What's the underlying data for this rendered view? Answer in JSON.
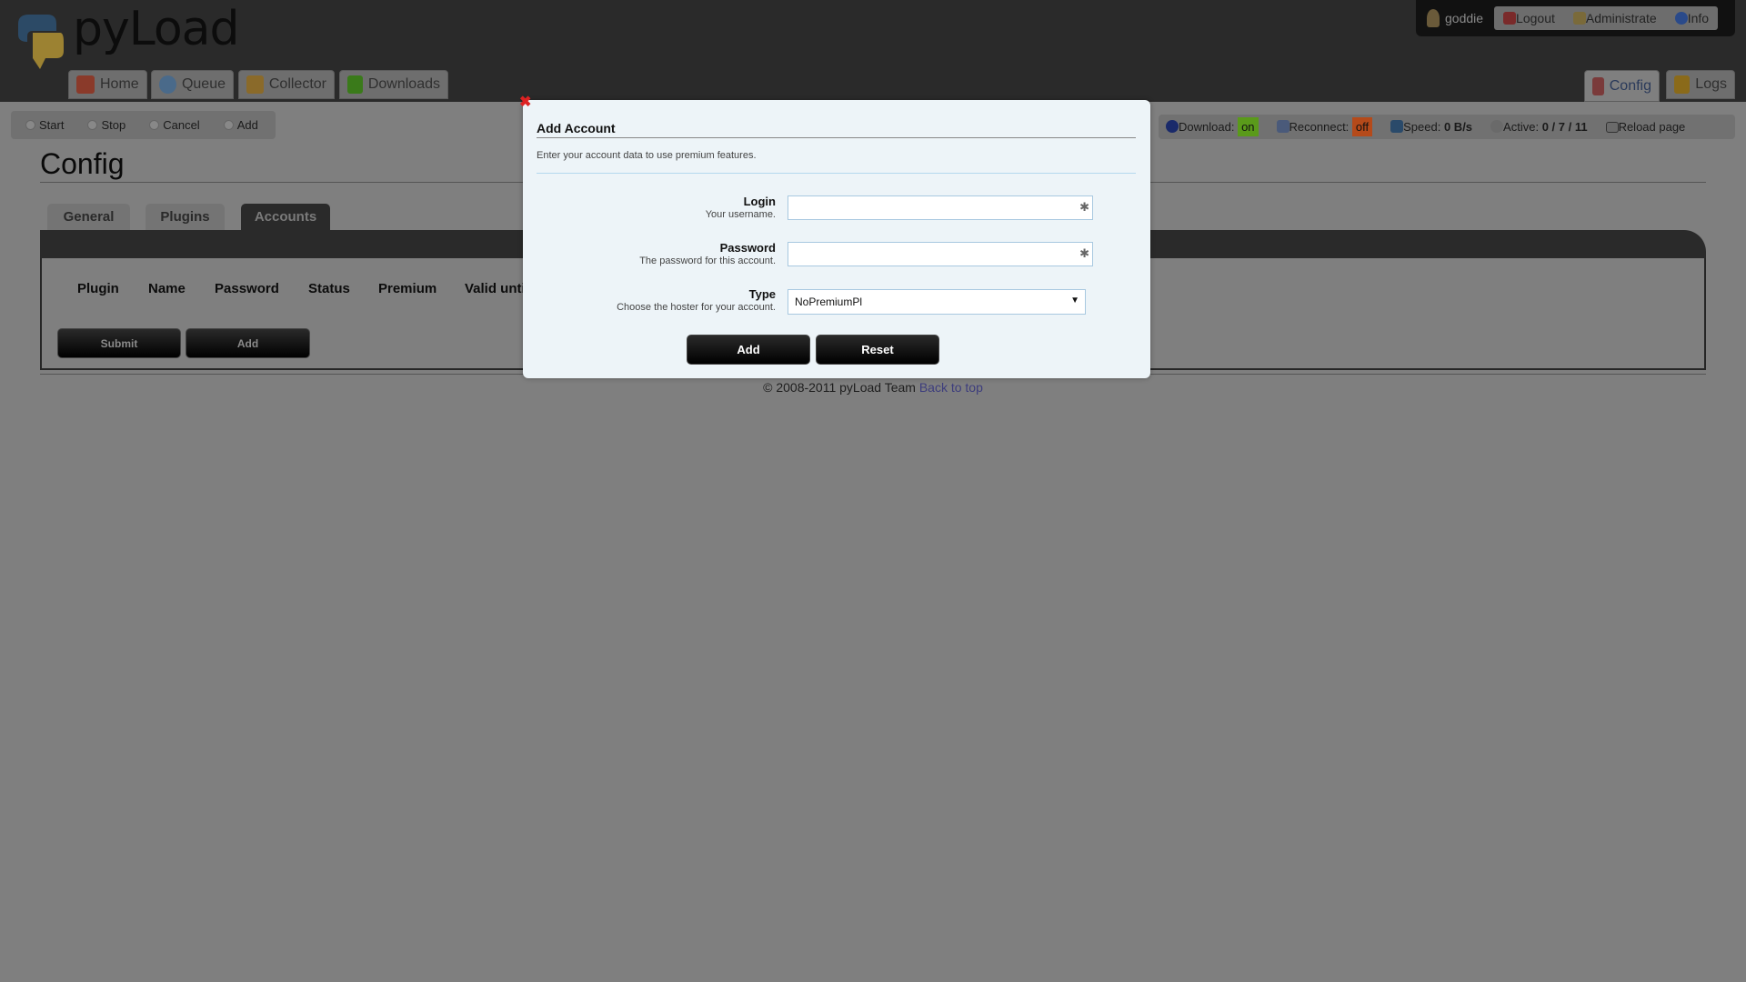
{
  "app": {
    "logo_text": "pyLoad"
  },
  "nav": {
    "items": [
      {
        "label": "Home",
        "icon": "home-icon"
      },
      {
        "label": "Queue",
        "icon": "clock-icon"
      },
      {
        "label": "Collector",
        "icon": "package-add-icon"
      },
      {
        "label": "Downloads",
        "icon": "download-arrow-icon"
      }
    ],
    "right": [
      {
        "label": "Config",
        "icon": "tools-icon"
      },
      {
        "label": "Logs",
        "icon": "logs-icon"
      }
    ]
  },
  "user": {
    "name": "goddie",
    "menu": [
      "Logout",
      "Administrate",
      "Info"
    ]
  },
  "toolbar": {
    "items": [
      "Start",
      "Stop",
      "Cancel",
      "Add"
    ]
  },
  "status": {
    "download_label": "Download:",
    "download_value": "on",
    "download_color": "#5a9a1a",
    "reconnect_label": "Reconnect:",
    "reconnect_value": "off",
    "reconnect_color": "#b54a1a",
    "speed_label": "Speed:",
    "speed_value": "0 B/s",
    "active_label": "Active:",
    "active_value": "0 / 7 / 11",
    "reload": "Reload page"
  },
  "page": {
    "title": "Config",
    "tabs": [
      "General",
      "Plugins",
      "Accounts"
    ],
    "active_tab": "Accounts",
    "columns": [
      "Plugin",
      "Name",
      "Password",
      "Status",
      "Premium",
      "Valid until"
    ],
    "submit": "Submit",
    "add": "Add"
  },
  "footer": {
    "text": "© 2008-2011 pyLoad Team",
    "link": "Back to top"
  },
  "modal": {
    "title": "Add Account",
    "description": "Enter your account data to use premium features.",
    "login_label": "Login",
    "login_sub": "Your username.",
    "login_value": "",
    "password_label": "Password",
    "password_sub": "The password for this account.",
    "password_value": "",
    "type_label": "Type",
    "type_sub": "Choose the hoster for your account.",
    "type_value": "NoPremiumPl",
    "add": "Add",
    "reset": "Reset"
  }
}
